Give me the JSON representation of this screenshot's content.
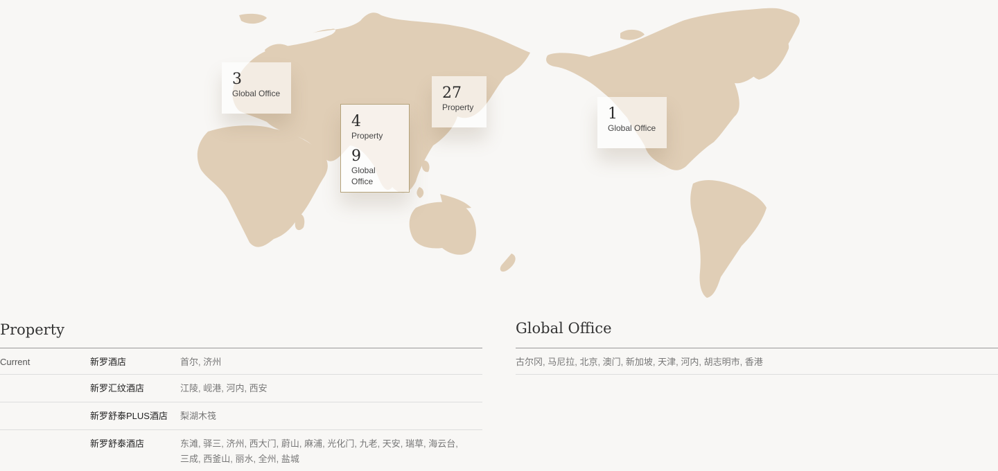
{
  "map": {
    "land_color": "#e0ceb6",
    "markers": [
      {
        "id": "europe",
        "entries": [
          {
            "number": "3",
            "label": "Global Office"
          }
        ]
      },
      {
        "id": "south-asia",
        "selected": true,
        "entries": [
          {
            "number": "4",
            "label": "Property"
          },
          {
            "number": "9",
            "label": "Global Office"
          }
        ]
      },
      {
        "id": "korea",
        "entries": [
          {
            "number": "27",
            "label": "Property"
          }
        ]
      },
      {
        "id": "north-america",
        "entries": [
          {
            "number": "1",
            "label": "Global Office"
          }
        ]
      }
    ]
  },
  "property": {
    "title": "Property",
    "rows": [
      {
        "category": "Current",
        "brand": "新罗酒店",
        "cities": "首尔, 济州"
      },
      {
        "category": "",
        "brand": "新罗汇纹酒店",
        "cities": "江陵, 岘港, 河内, 西安"
      },
      {
        "category": "",
        "brand": "新罗舒泰PLUS酒店",
        "cities": "梨湖木筏"
      },
      {
        "category": "",
        "brand": "新罗舒泰酒店",
        "cities": "东滩, 驿三, 济州, 西大门, 蔚山, 麻浦, 光化门, 九老, 天安, 瑞草, 海云台, 三成, 西釜山, 丽水, 全州, 盐城"
      }
    ]
  },
  "global_office": {
    "title": "Global Office",
    "cities": "古尔冈,  马尼拉,  北京,  澳门,  新加坡,  天津,  河内,  胡志明市,  香港"
  }
}
